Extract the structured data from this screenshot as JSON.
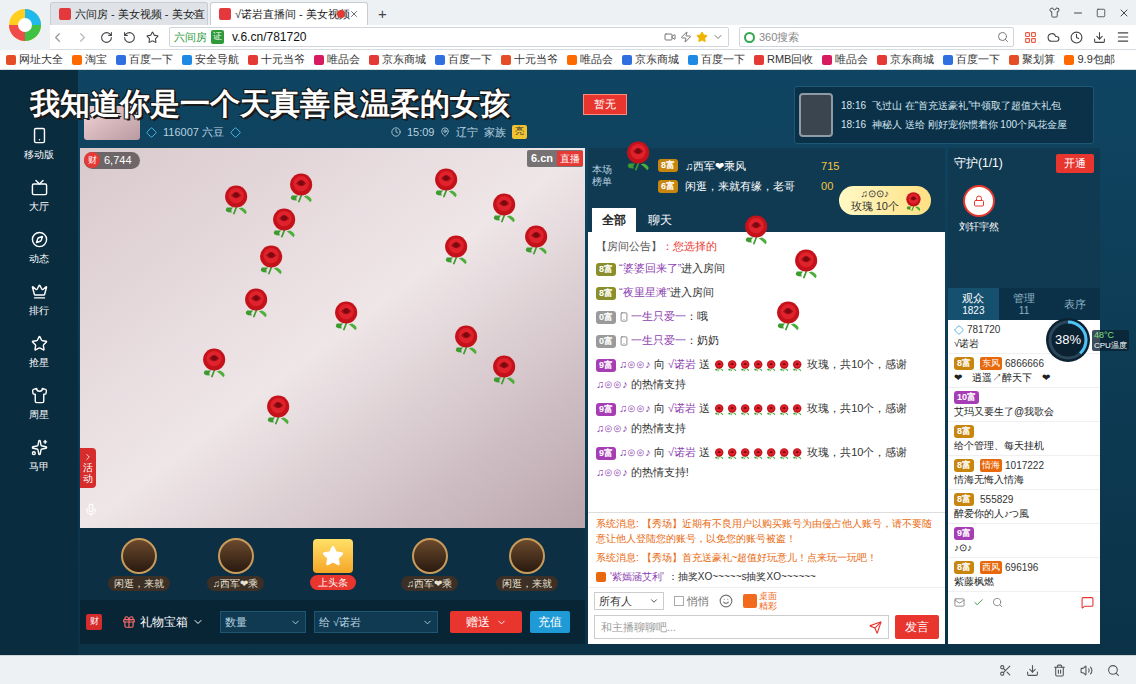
{
  "browser": {
    "tabs": [
      {
        "label": "六间房 - 美女视频 - 美女直",
        "selected": false
      },
      {
        "label": "√诺岩直播间 - 美女视频",
        "selected": true
      }
    ],
    "new_tab": "+",
    "address": {
      "site": "六间房",
      "verified": "证",
      "url": "v.6.cn/781720"
    },
    "search": {
      "placeholder": "360搜索"
    },
    "bookmarks": [
      "网址大全",
      "淘宝",
      "百度一下",
      "安全导航",
      "十元当爷",
      "唯品会",
      "京东商城",
      "百度一下",
      "十元当爷",
      "唯品会",
      "京东商城",
      "百度一下",
      "RMB回收",
      "唯品会",
      "京东商城",
      "百度一下",
      "聚划算",
      "9.9包邮"
    ]
  },
  "nav": [
    {
      "label": "移动版"
    },
    {
      "label": "大厅"
    },
    {
      "label": "动态"
    },
    {
      "label": "排行"
    },
    {
      "label": "抢星"
    },
    {
      "label": "周星"
    },
    {
      "label": "马甲"
    }
  ],
  "marquee": "我知道你是一个天真善良温柔的女孩",
  "host": {
    "beans": "116007 六豆",
    "time": "15:09",
    "location": "辽宁",
    "family": "家族",
    "family_tag": "亮"
  },
  "badge": "暂无",
  "notices": [
    {
      "time": "18:16",
      "text": "飞过山 在“首充送豪礼”中领取了超值大礼包"
    },
    {
      "time": "18:16",
      "text": "神秘人 送给 刚好宠你惯着你 100个风花金屋"
    }
  ],
  "video": {
    "viewers_icon": "财",
    "viewers": "6,744",
    "logo": "6.cn",
    "live": "直播",
    "side_tab": "活动"
  },
  "gift_row": [
    {
      "label": "闲逛，来就",
      "kind": "avatar"
    },
    {
      "label": "♫西军❤乘",
      "kind": "avatar"
    },
    {
      "label": "上头条",
      "kind": "headline"
    },
    {
      "label": "♫西军❤乘",
      "kind": "avatar"
    },
    {
      "label": "闲逛，来就",
      "kind": "avatar"
    }
  ],
  "toolbar": {
    "wealth": "财",
    "gift_box": "礼物宝箱",
    "quantity": "数量",
    "to": "给 √诺岩",
    "send": "赠送",
    "recharge": "充值"
  },
  "ranking": {
    "label": "本场榜单",
    "entries": [
      {
        "level": "8富",
        "name": "♫西军❤乘风",
        "score": "715"
      },
      {
        "level": "6富",
        "name": "闲逛，来就有缘，老哥",
        "score": "00"
      }
    ]
  },
  "gift_popup": {
    "sender": "♫⊙⊙♪",
    "gift": "玫瑰",
    "count": "10个"
  },
  "chat_tabs": [
    {
      "label": "全部",
      "selected": true
    },
    {
      "label": "聊天",
      "selected": false
    }
  ],
  "messages": [
    {
      "kind": "notice",
      "label": "【房间公告】",
      "text": "：您选择的"
    },
    {
      "kind": "enter",
      "level": "8富",
      "badge_color": "#8a8f2a",
      "name": "“婆婆回来了”",
      "text": "进入房间"
    },
    {
      "kind": "enter",
      "level": "8富",
      "badge_color": "#8a8f2a",
      "name": "“夜里星滩”",
      "text": "进入房间"
    },
    {
      "kind": "chat",
      "level": "0富",
      "badge_color": "#9a9a9a",
      "name": "一生只爱一",
      "text": "：哦"
    },
    {
      "kind": "chat",
      "level": "0富",
      "badge_color": "#9a9a9a",
      "name": "一生只爱一",
      "text": "：奶奶"
    },
    {
      "kind": "gift",
      "level": "9富",
      "badge_color": "#a73db5",
      "sender": "♫⊙⊙♪",
      "verb": "向",
      "target": "√诺岩",
      "action": "送",
      "rose_icons": 7,
      "text": "玫瑰，共10个，感谢",
      "thanked": "♫⊙⊙♪",
      "tail": "的热情支持"
    },
    {
      "kind": "gift",
      "level": "9富",
      "badge_color": "#a73db5",
      "sender": "♫⊙⊙♪",
      "verb": "向",
      "target": "√诺岩",
      "action": "送",
      "rose_icons": 7,
      "text": "玫瑰，共10个，感谢",
      "thanked": "♫⊙⊙♪",
      "tail": "的热情支持"
    },
    {
      "kind": "gift",
      "level": "9富",
      "badge_color": "#a73db5",
      "sender": "♫⊙⊙♪",
      "verb": "向",
      "target": "√诺岩",
      "action": "送",
      "rose_icons": 7,
      "text": "玫瑰，共10个，感谢",
      "thanked": "♫⊙⊙♪",
      "tail": "的热情支持!"
    }
  ],
  "system_messages": [
    {
      "label": "系统消息:",
      "text": "【秀场】近期有不良用户以购买账号为由侵占他人账号，请不要随意让他人登陆您的账号，以免您的账号被盗！"
    },
    {
      "label": "系统消息:",
      "text": "【秀场】首充送豪礼~超值好玩意儿！点来玩一玩吧！"
    }
  ],
  "last_message": {
    "name": "'紫嫣涵艾利'",
    "text": "：抽奖XO~~~~~s抽奖XO~~~~~~"
  },
  "chat_input": {
    "scope": "所有人",
    "whisper": "悄悄",
    "whisper_checked": false,
    "promo": "桌面精彩",
    "placeholder": "和主播聊聊吧...",
    "send": "发言"
  },
  "guard": {
    "title": "守护(1/1)",
    "button": "开通",
    "members": [
      {
        "name": "刘轩宇然"
      }
    ]
  },
  "audience_tabs": [
    {
      "label": "观众",
      "count": "1823",
      "selected": true
    },
    {
      "label": "管理",
      "count": "11",
      "selected": false
    },
    {
      "label": "表序",
      "count": "",
      "selected": false
    }
  ],
  "users": [
    {
      "level": "",
      "badge_color": "#3aa0e0",
      "id": "781720",
      "tag": "",
      "name": "√诺岩"
    },
    {
      "level": "8富",
      "badge_color": "#c9860f",
      "id": "6866666",
      "tag": "东风",
      "name": "❤ゞ逍遥↗醉天下ゞ❤"
    },
    {
      "level": "10富",
      "badge_color": "#a73db5",
      "id": "",
      "tag": "",
      "name": "艾玛又要生了@我歌会"
    },
    {
      "level": "8富",
      "badge_color": "#c9860f",
      "id": "",
      "tag": "",
      "name": "给个管理、每天挂机"
    },
    {
      "level": "8富",
      "badge_color": "#c9860f",
      "id": "1017222",
      "tag": "情海",
      "name": "情海无悔入情海"
    },
    {
      "level": "8富",
      "badge_color": "#c9860f",
      "id": "555829",
      "tag": "",
      "name": "醉爱你的人♪つ風ゝ"
    },
    {
      "level": "9富",
      "badge_color": "#a73db5",
      "id": "",
      "tag": "",
      "name": "♪⊙♪"
    },
    {
      "level": "8富",
      "badge_color": "#c9860f",
      "id": "696196",
      "tag": "西风",
      "name": "紫藤枫燃"
    }
  ],
  "cpu": {
    "percent": "38%",
    "level": 0.38,
    "temp": "48°C",
    "label": "CPU温度"
  }
}
